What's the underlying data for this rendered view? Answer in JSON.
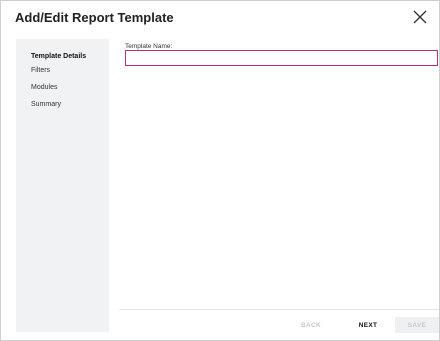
{
  "dialog": {
    "title": "Add/Edit Report Template",
    "close_icon": "close-icon"
  },
  "sidebar": {
    "items": [
      {
        "label": "Template Details",
        "active": true
      },
      {
        "label": "Filters",
        "active": false
      },
      {
        "label": "Modules",
        "active": false
      },
      {
        "label": "Summary",
        "active": false
      }
    ]
  },
  "form": {
    "template_name_label": "Template Name:",
    "template_name_value": "",
    "input_border_color": "#b0307a"
  },
  "footer": {
    "back_label": "BACK",
    "next_label": "NEXT",
    "save_label": "SAVE",
    "back_enabled": false,
    "save_enabled": false
  }
}
